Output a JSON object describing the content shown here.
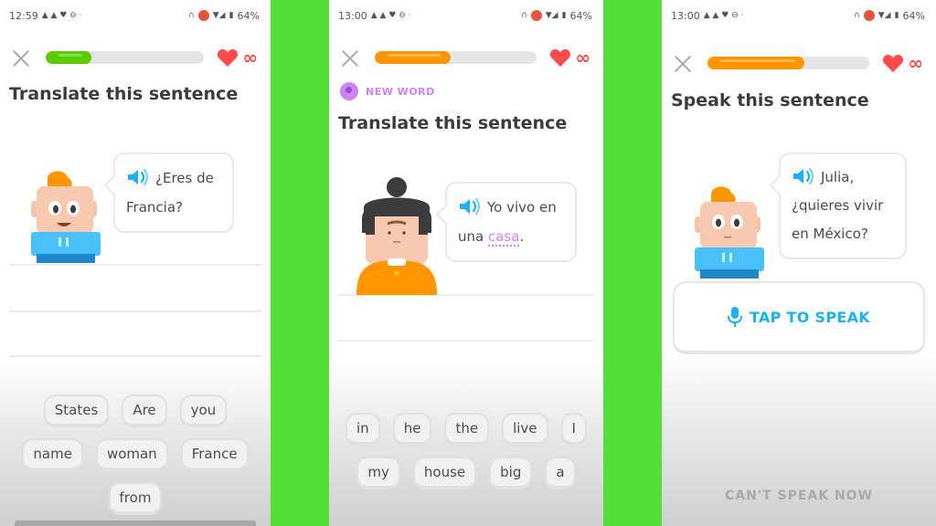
{
  "colors": {
    "background_green": "#55dd3a",
    "progress_green": "#58cc02",
    "progress_orange": "#ff9600",
    "heart_red": "#ff4b4b",
    "new_word_purple": "#ce82ff",
    "speak_blue": "#1cb0f6"
  },
  "panels": [
    {
      "status": {
        "time": "12:59",
        "battery": "64%"
      },
      "progress_percent": 29,
      "progress_color": "#58cc02",
      "lives": "∞",
      "title": "Translate this sentence",
      "prompt_lines": [
        "¿Eres de",
        "Francia?"
      ],
      "word_bank": [
        "States",
        "Are",
        "you",
        "name",
        "woman",
        "France",
        "from"
      ]
    },
    {
      "status": {
        "time": "13:00",
        "battery": "64%"
      },
      "progress_percent": 47,
      "progress_color": "#ff9600",
      "lives": "∞",
      "badge": "NEW WORD",
      "title": "Translate this sentence",
      "prompt_line1": "Yo vivo en",
      "prompt_line2_prefix": "una ",
      "prompt_new_term": "casa",
      "prompt_line2_suffix": ".",
      "word_bank": [
        "in",
        "he",
        "the",
        "live",
        "I",
        "my",
        "house",
        "big",
        "a"
      ]
    },
    {
      "status": {
        "time": "13:00",
        "battery": "64%"
      },
      "progress_percent": 60,
      "progress_color": "#ff9600",
      "lives": "∞",
      "title": "Speak this sentence",
      "prompt_lines": [
        "Julia,",
        "¿quieres vivir",
        "en México?"
      ],
      "tap_to_speak": "TAP TO SPEAK",
      "cant_speak": "CAN'T SPEAK NOW"
    }
  ]
}
